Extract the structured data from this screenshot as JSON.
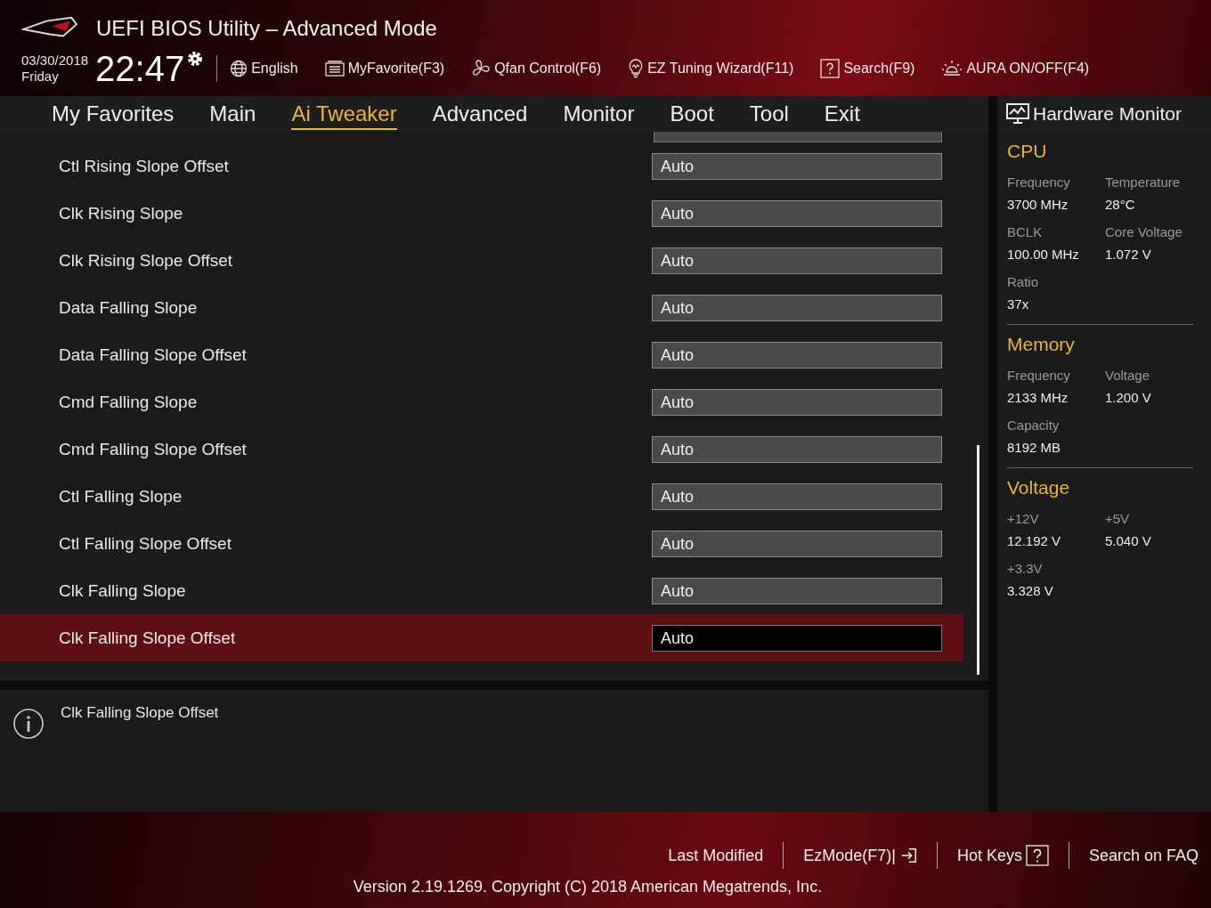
{
  "window": {
    "title": "UEFI BIOS Utility – Advanced Mode"
  },
  "clock": {
    "date": "03/30/2018",
    "day": "Friday",
    "time": "22:47"
  },
  "toolbar": [
    {
      "kind": "language",
      "label": "English"
    },
    {
      "kind": "favorite",
      "label": "MyFavorite(F3)"
    },
    {
      "kind": "fan",
      "label": "Qfan Control(F6)"
    },
    {
      "kind": "wizard",
      "label": "EZ Tuning Wizard(F11)"
    },
    {
      "kind": "search",
      "label": "Search(F9)"
    },
    {
      "kind": "aura",
      "label": "AURA ON/OFF(F4)"
    }
  ],
  "tabs": [
    {
      "label": "My Favorites",
      "selected": false
    },
    {
      "label": "Main",
      "selected": false
    },
    {
      "label": "Ai Tweaker",
      "selected": true
    },
    {
      "label": "Advanced",
      "selected": false
    },
    {
      "label": "Monitor",
      "selected": false
    },
    {
      "label": "Boot",
      "selected": false
    },
    {
      "label": "Tool",
      "selected": false
    },
    {
      "label": "Exit",
      "selected": false
    }
  ],
  "settings": [
    {
      "label": "Ctl Rising Slope Offset",
      "value": "Auto",
      "selected": false
    },
    {
      "label": "Clk Rising Slope",
      "value": "Auto",
      "selected": false
    },
    {
      "label": "Clk Rising Slope Offset",
      "value": "Auto",
      "selected": false
    },
    {
      "label": "Data Falling Slope",
      "value": "Auto",
      "selected": false
    },
    {
      "label": "Data Falling Slope Offset",
      "value": "Auto",
      "selected": false
    },
    {
      "label": "Cmd Falling Slope",
      "value": "Auto",
      "selected": false
    },
    {
      "label": "Cmd Falling Slope Offset",
      "value": "Auto",
      "selected": false
    },
    {
      "label": "Ctl Falling Slope",
      "value": "Auto",
      "selected": false
    },
    {
      "label": "Ctl Falling Slope Offset",
      "value": "Auto",
      "selected": false
    },
    {
      "label": "Clk Falling Slope",
      "value": "Auto",
      "selected": false
    },
    {
      "label": "Clk Falling Slope Offset",
      "value": "Auto",
      "selected": true
    }
  ],
  "help": {
    "text": "Clk Falling Slope Offset"
  },
  "hardware_monitor": {
    "title": "Hardware Monitor",
    "sections": [
      {
        "title": "CPU",
        "readings": [
          {
            "label": "Frequency",
            "value": "3700 MHz"
          },
          {
            "label": "Temperature",
            "value": "28°C"
          },
          {
            "label": "BCLK",
            "value": "100.00 MHz"
          },
          {
            "label": "Core Voltage",
            "value": "1.072 V"
          },
          {
            "label": "Ratio",
            "value": "37x"
          }
        ]
      },
      {
        "title": "Memory",
        "readings": [
          {
            "label": "Frequency",
            "value": "2133 MHz"
          },
          {
            "label": "Voltage",
            "value": "1.200 V"
          },
          {
            "label": "Capacity",
            "value": "8192 MB"
          }
        ]
      },
      {
        "title": "Voltage",
        "readings": [
          {
            "label": "+12V",
            "value": "12.192 V"
          },
          {
            "label": "+5V",
            "value": "5.040 V"
          },
          {
            "label": "+3.3V",
            "value": "3.328 V"
          }
        ]
      }
    ]
  },
  "footer": {
    "links": [
      {
        "kind": "text",
        "label": "Last Modified"
      },
      {
        "kind": "exit",
        "label": "EzMode(F7)|"
      },
      {
        "kind": "help",
        "label": "Hot Keys"
      },
      {
        "kind": "text",
        "label": "Search on FAQ"
      }
    ],
    "version": "Version 2.19.1269. Copyright (C) 2018 American Megatrends, Inc."
  }
}
